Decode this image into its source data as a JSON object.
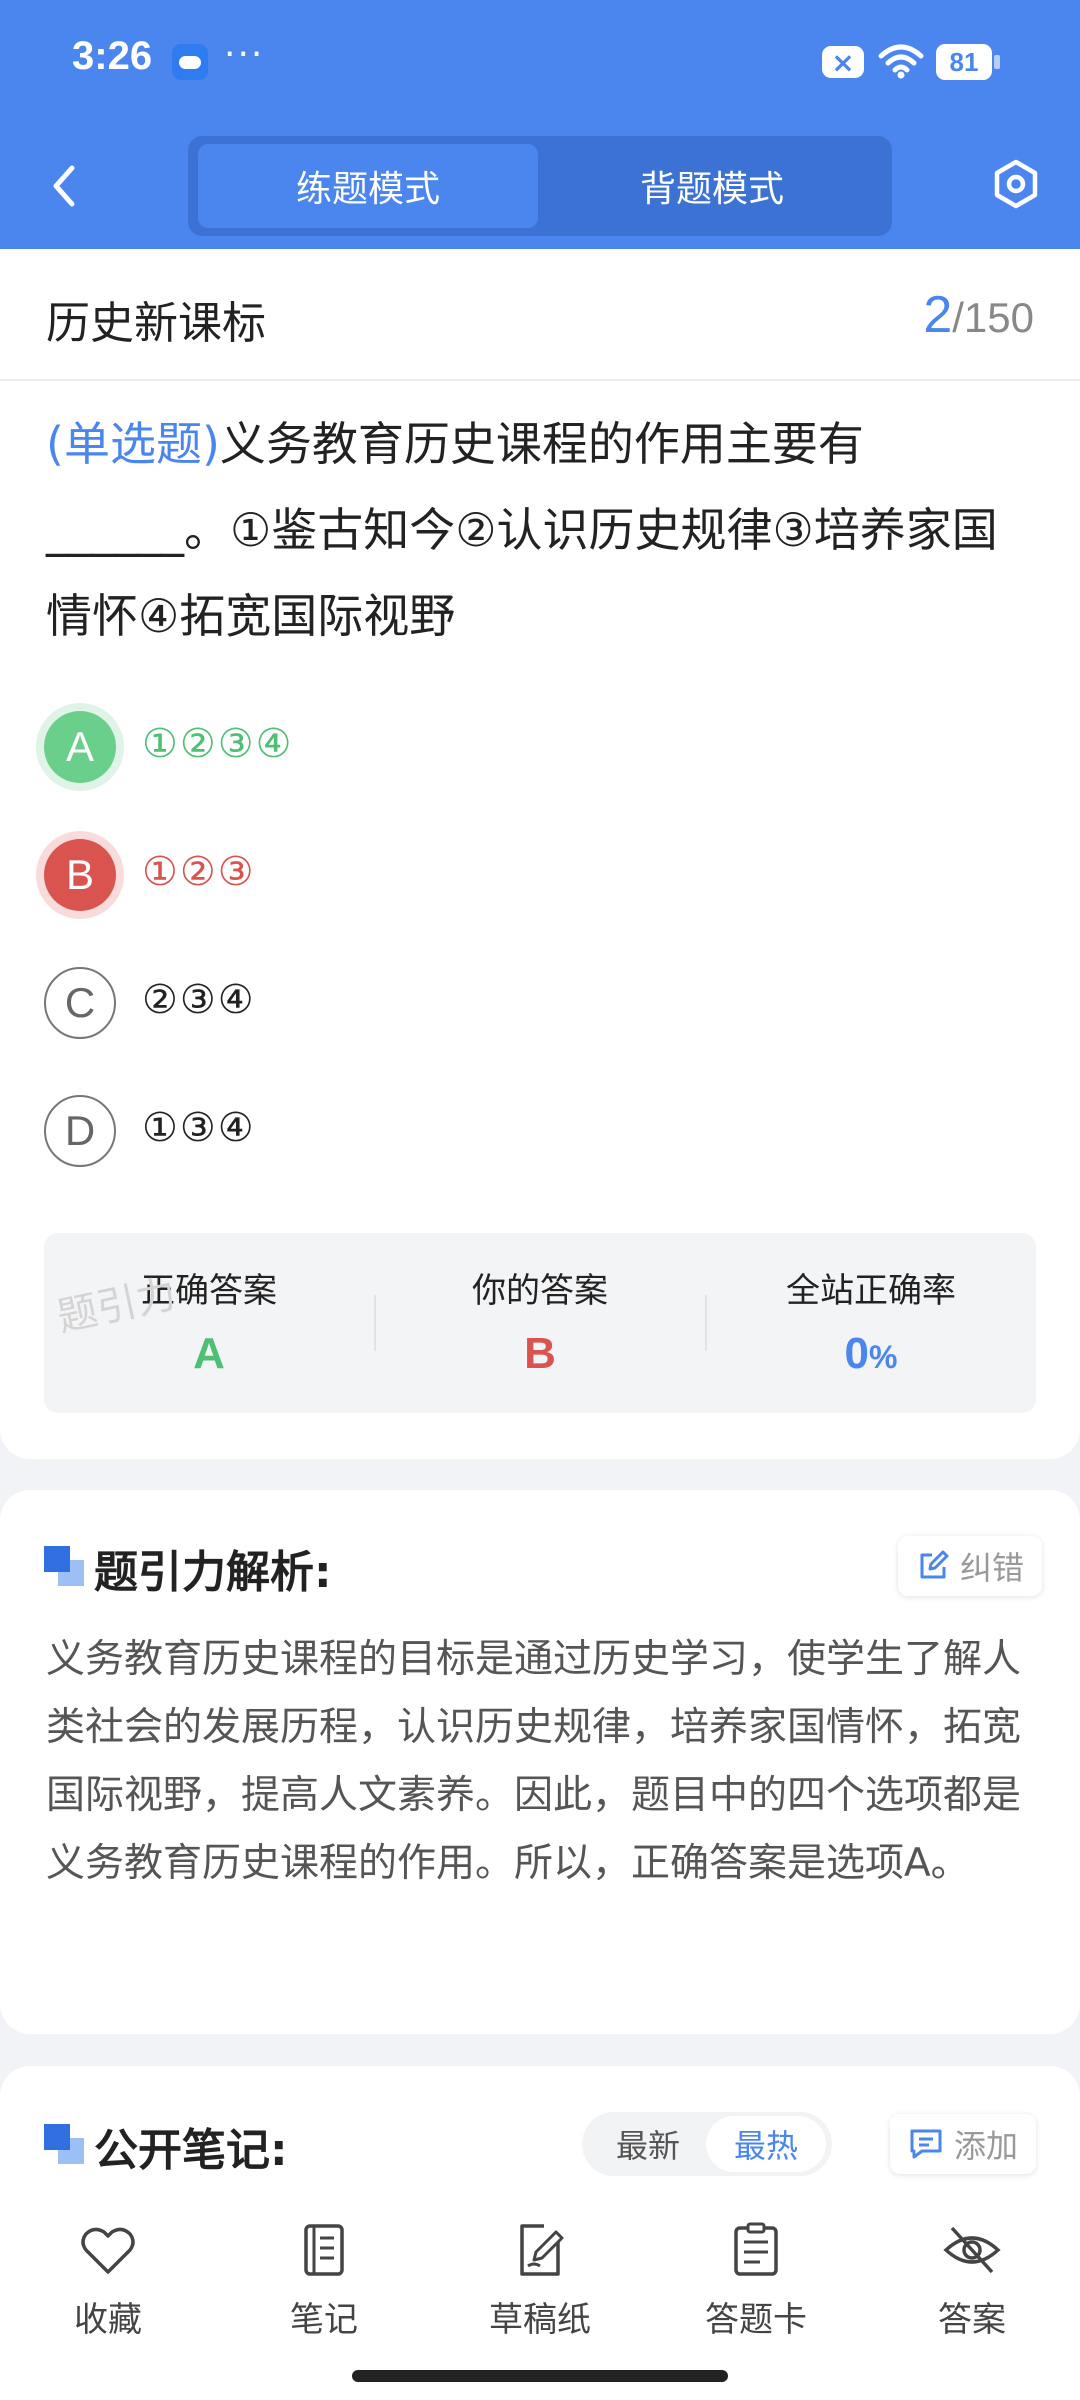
{
  "status_bar": {
    "time": "3:26",
    "dots": "···",
    "battery": "81"
  },
  "header": {
    "tabs": [
      {
        "label": "练题模式",
        "active": true
      },
      {
        "label": "背题模式",
        "active": false
      }
    ]
  },
  "question_header": {
    "subject": "历史新课标",
    "current": "2",
    "total": "/150"
  },
  "question": {
    "type": "(单选题)",
    "text": "义务教育历史课程的作用主要有______。①鉴古知今②认识历史规律③培养家国情怀④拓宽国际视野"
  },
  "options": [
    {
      "letter": "A",
      "text": "①②③④",
      "state": "correct"
    },
    {
      "letter": "B",
      "text": "①②③",
      "state": "wrong"
    },
    {
      "letter": "C",
      "text": "②③④",
      "state": "plain"
    },
    {
      "letter": "D",
      "text": "①③④",
      "state": "plain"
    }
  ],
  "answer_summary": {
    "watermark": "题引力",
    "correct_label": "正确答案",
    "correct_value": "A",
    "yours_label": "你的答案",
    "yours_value": "B",
    "rate_label": "全站正确率",
    "rate_value": "0",
    "rate_unit": "%"
  },
  "colors": {
    "accent": "#4a86ee",
    "correct": "#4fbf74",
    "wrong": "#d9534f"
  },
  "analysis": {
    "title": "题引力解析:",
    "report_button": "纠错",
    "text": "义务教育历史课程的目标是通过历史学习，使学生了解人类社会的发展历程，认识历史规律，培养家国情怀，拓宽国际视野，提高人文素养。因此，题目中的四个选项都是义务教育历史课程的作用。所以，正确答案是选项A。"
  },
  "notes": {
    "title": "公开笔记:",
    "sort_latest": "最新",
    "sort_hot": "最热",
    "add_button": "添加"
  },
  "bottom_nav": [
    {
      "label": "收藏",
      "icon": "heart-icon"
    },
    {
      "label": "笔记",
      "icon": "notebook-icon"
    },
    {
      "label": "草稿纸",
      "icon": "draft-icon"
    },
    {
      "label": "答题卡",
      "icon": "answer-sheet-icon"
    },
    {
      "label": "答案",
      "icon": "eye-off-icon"
    }
  ]
}
